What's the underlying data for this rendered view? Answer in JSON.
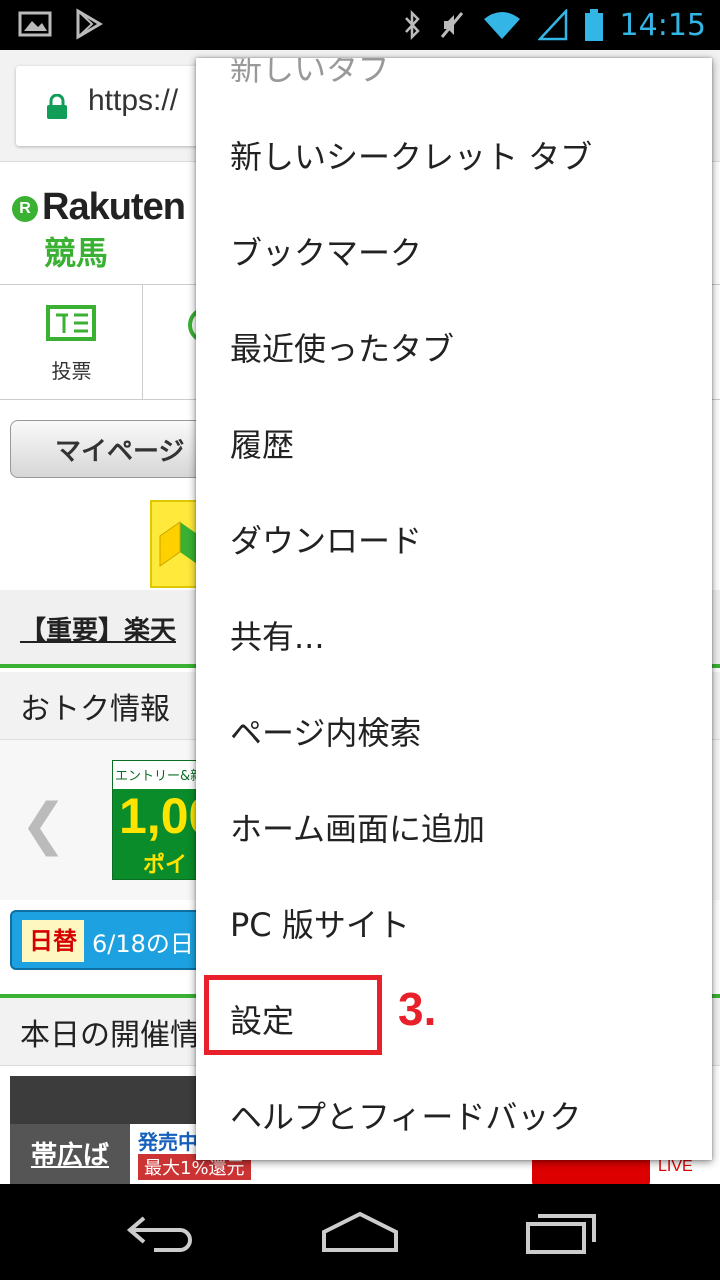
{
  "status_bar": {
    "time": "14:15",
    "icons": [
      "image-icon",
      "play-store-icon",
      "bluetooth-icon",
      "mute-icon",
      "wifi-icon",
      "signal-icon",
      "battery-icon"
    ]
  },
  "browser": {
    "url": "https://"
  },
  "page": {
    "brand_name": "Rakuten",
    "brand_mark": "R",
    "brand_sub": "競馬",
    "nav_vote_label": "投票",
    "mypage_button": "マイページ",
    "notice": "【重要】楽天",
    "section_deals": "おトク情報",
    "promo_top": "エントリー&新規",
    "promo_big": "1,00",
    "promo_point": "ポイ",
    "daily_tag": "日替",
    "daily_text": "6/18の日",
    "section_today": "本日の開催情",
    "venue": "帯広ば",
    "sale": "発売中",
    "refund": "最大1%還元",
    "live": "LIVE"
  },
  "menu": {
    "partial_top": "新しいタブ",
    "items": [
      "新しいシークレット タブ",
      "ブックマーク",
      "最近使ったタブ",
      "履歴",
      "ダウンロード",
      "共有...",
      "ページ内検索",
      "ホーム画面に追加",
      "PC 版サイト",
      "設定",
      "ヘルプとフィードバック"
    ]
  },
  "annotation": {
    "step": "3."
  },
  "colors": {
    "accent_green": "#3ab133",
    "highlight_red": "#e8202a",
    "status_blue": "#33b5e5"
  }
}
